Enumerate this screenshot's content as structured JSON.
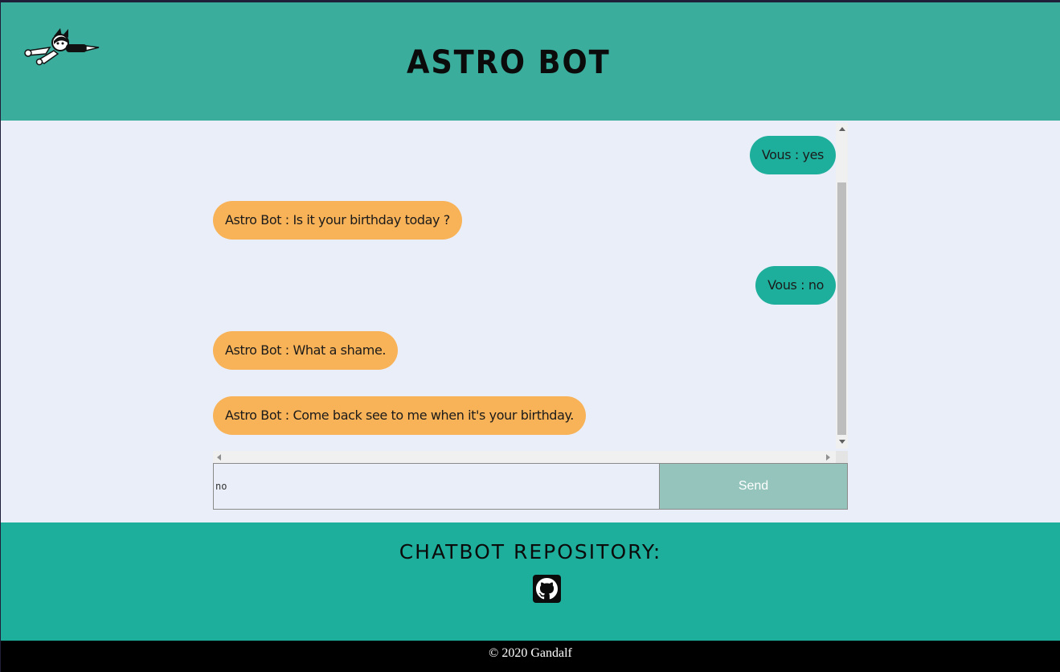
{
  "header": {
    "title": "ASTRO BOT",
    "logo_icon": "astro-boy-flying-icon"
  },
  "chat": {
    "messages": [
      {
        "sender": "user",
        "text": "Vous : yes"
      },
      {
        "sender": "bot",
        "text": "Astro Bot : Is it your birthday today ?"
      },
      {
        "sender": "user",
        "text": "Vous : no"
      },
      {
        "sender": "bot",
        "text": "Astro Bot : What a shame."
      },
      {
        "sender": "bot",
        "text": "Astro Bot : Come back see to me when it's your birthday."
      }
    ]
  },
  "composer": {
    "value": "no",
    "send_label": "Send"
  },
  "footer": {
    "repo_title": "CHATBOT REPOSITORY:",
    "repo_icon": "github-icon",
    "copyright": "© 2020 Gandalf"
  },
  "colors": {
    "header_bg": "#3aad9c",
    "footer_bg": "#1eaf9c",
    "user_bubble": "#1eaf9c",
    "bot_bubble": "#f8b257",
    "send_button": "#94c4bb",
    "page_bg": "#eaeef8"
  }
}
